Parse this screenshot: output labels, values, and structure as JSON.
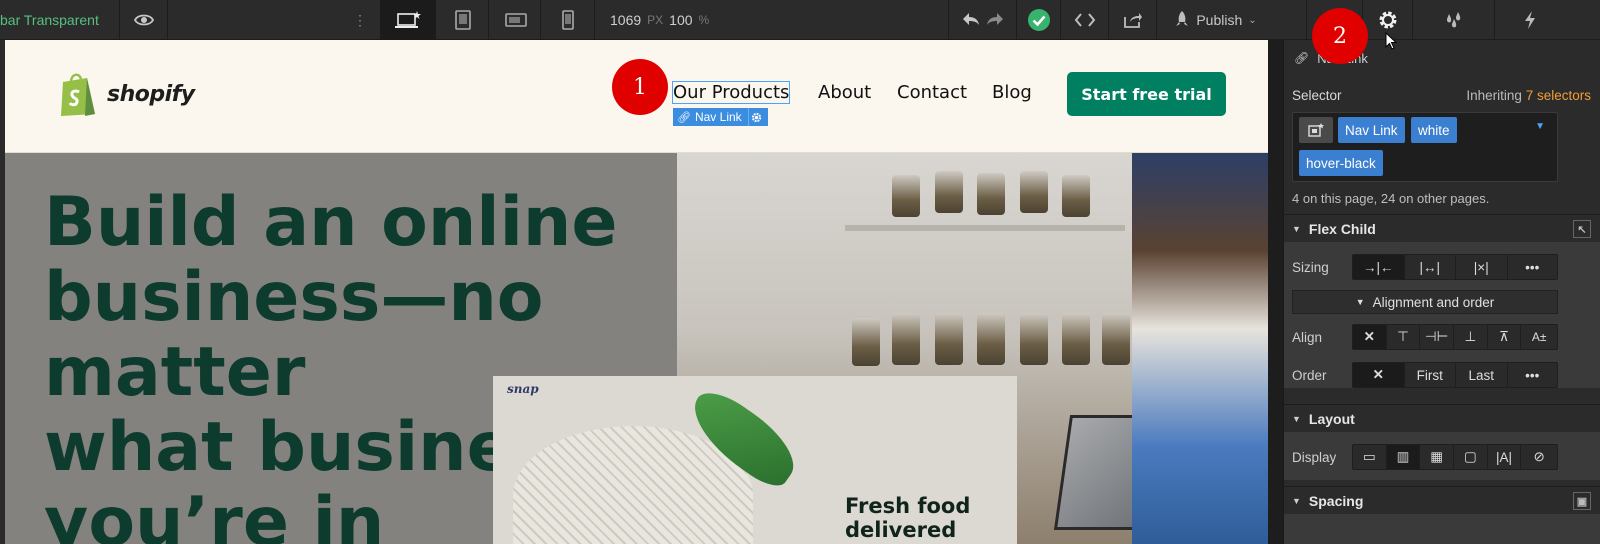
{
  "toolbar": {
    "left_label": "bar Transparent",
    "width_value": "1069",
    "width_unit": "PX",
    "zoom_value": "100",
    "zoom_unit": "%",
    "publish_label": "Publish"
  },
  "site": {
    "logo_text": "shopify",
    "nav": [
      "Our Products",
      "About",
      "Contact",
      "Blog"
    ],
    "nav_tag_label": "Nav Link",
    "cta_label": "Start free trial",
    "hero_lines": [
      "Build an online",
      "business—no",
      "matter",
      "what business",
      "you’re in"
    ],
    "card_brand": "snap",
    "card_text": [
      "Fresh food",
      "delivered"
    ]
  },
  "badges": [
    "1",
    "2"
  ],
  "panel": {
    "element_label": "Nav Link",
    "selector_label": "Selector",
    "inheriting_label": "Inheriting",
    "inheriting_count": "7 selectors",
    "chips": [
      "Nav Link",
      "white",
      "hover-black"
    ],
    "selector_note": "4 on this page, 24 on other pages.",
    "flex_child_title": "Flex Child",
    "sizing_label": "Sizing",
    "alignment_order_label": "Alignment and order",
    "align_label": "Align",
    "order_label": "Order",
    "order_first": "First",
    "order_last": "Last",
    "layout_title": "Layout",
    "display_label": "Display",
    "spacing_title": "Spacing"
  },
  "colors": {
    "accent_blue": "#3b7fd0",
    "cta_green": "#008060",
    "hero_text": "#0d3b2e",
    "badge_red": "#e00000",
    "inherit_orange": "#f29d38"
  }
}
